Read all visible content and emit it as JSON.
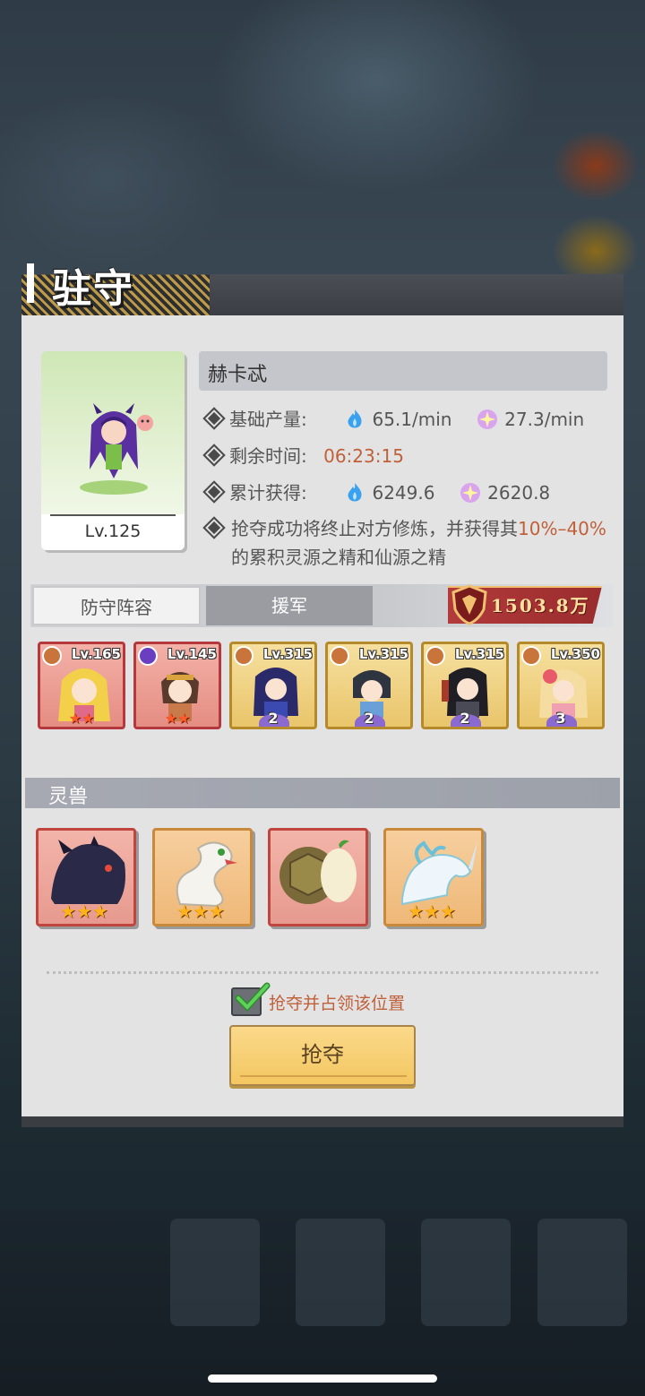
{
  "panel": {
    "title": "驻守"
  },
  "defender": {
    "name": "赫卡忒",
    "level": "Lv.125",
    "base_output_label": "基础产量:",
    "output_blue": "65.1/min",
    "output_purple": "27.3/min",
    "time_label": "剩余时间:",
    "time_value": "06:23:15",
    "total_label": "累计获得:",
    "total_blue": "6249.6",
    "total_purple": "2620.8",
    "desc_part1": "抢夺成功将终止对方修炼，并获得其",
    "desc_percent": "10%–40%",
    "desc_part2": "的累积灵源之精和仙源之精"
  },
  "tabs": [
    {
      "label": "防守阵容",
      "active": true
    },
    {
      "label": "援军",
      "active": false
    }
  ],
  "power": "1503.8万",
  "heroes": [
    {
      "level": "Lv.165",
      "rarity": "red",
      "badge": "orange",
      "stars": "★★",
      "count": ""
    },
    {
      "level": "Lv.145",
      "rarity": "red",
      "badge": "purple",
      "stars": "★★",
      "count": ""
    },
    {
      "level": "Lv.315",
      "rarity": "gold",
      "badge": "orange",
      "stars": "",
      "count": "2"
    },
    {
      "level": "Lv.315",
      "rarity": "gold",
      "badge": "orange",
      "stars": "",
      "count": "2"
    },
    {
      "level": "Lv.315",
      "rarity": "gold",
      "badge": "orange",
      "stars": "",
      "count": "2"
    },
    {
      "level": "Lv.350",
      "rarity": "gold",
      "badge": "orange",
      "stars": "",
      "count": "3"
    }
  ],
  "beasts": {
    "title": "灵兽",
    "items": [
      {
        "name": "dark-dragon",
        "rarity": "red",
        "stars": "★★★"
      },
      {
        "name": "white-serpent",
        "rarity": "orange",
        "stars": "★★★"
      },
      {
        "name": "turtle",
        "rarity": "red",
        "stars": ""
      },
      {
        "name": "water-horse",
        "rarity": "orange",
        "stars": "★★★"
      }
    ]
  },
  "occupy": {
    "label": "抢夺并占领该位置",
    "checked": true
  },
  "action_button": "抢夺",
  "colors": {
    "accent": "#c0603a",
    "panel_bg": "#e3e3e3",
    "button": "#f3c761"
  }
}
